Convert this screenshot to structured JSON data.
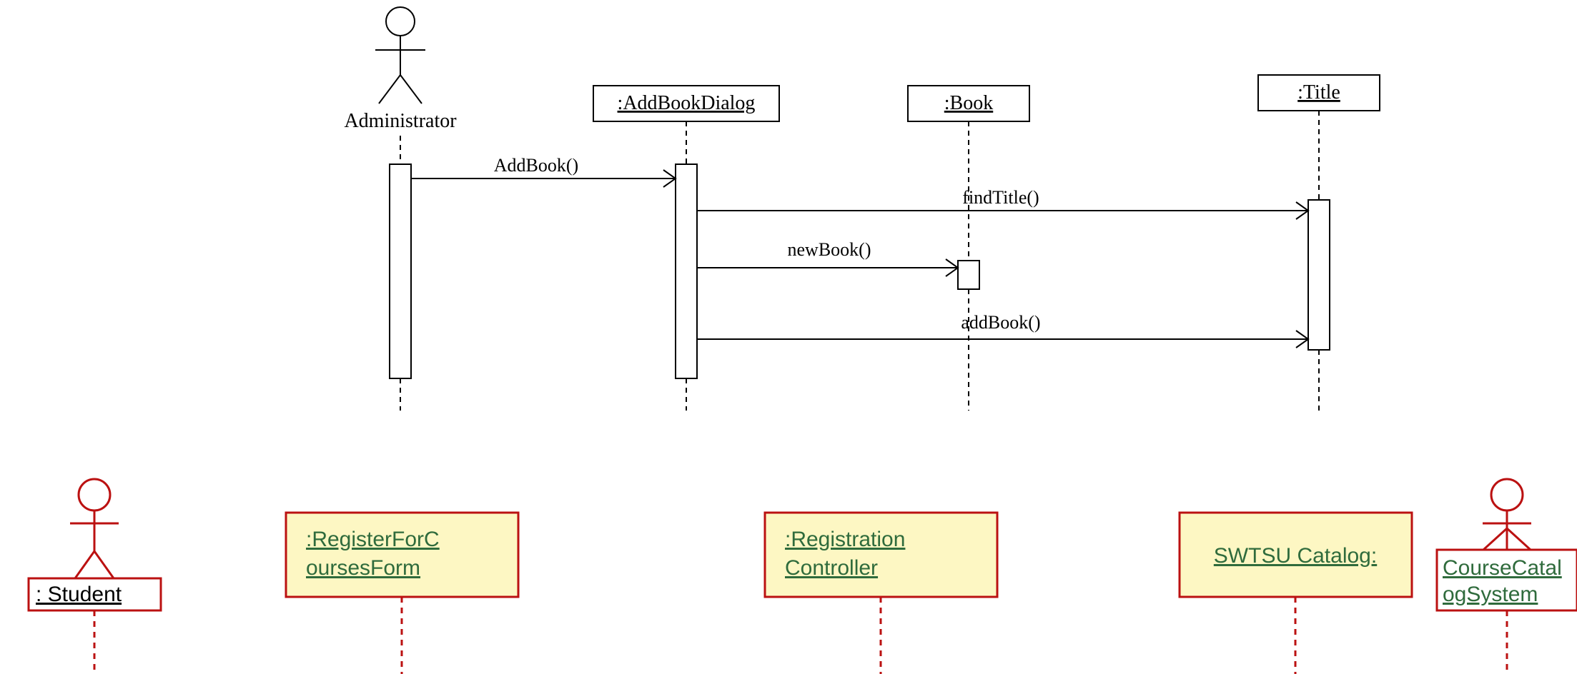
{
  "diagram1": {
    "actor": {
      "label": "Administrator"
    },
    "objects": {
      "addBookDialog": ":AddBookDialog",
      "book": ":Book",
      "title": ":Title"
    },
    "messages": {
      "m1": "AddBook()",
      "m2": "findTitle()",
      "m3": "newBook()",
      "m4": "addBook()"
    }
  },
  "diagram2": {
    "student": ": Student",
    "registerForm1": ":RegisterForC",
    "registerForm2": "oursesForm",
    "regController1": ":Registration",
    "regController2": "Controller",
    "swtsu": "SWTSU Catalog:",
    "courseCatalog1": "CourseCatal",
    "courseCatalog2": "ogSystem"
  }
}
